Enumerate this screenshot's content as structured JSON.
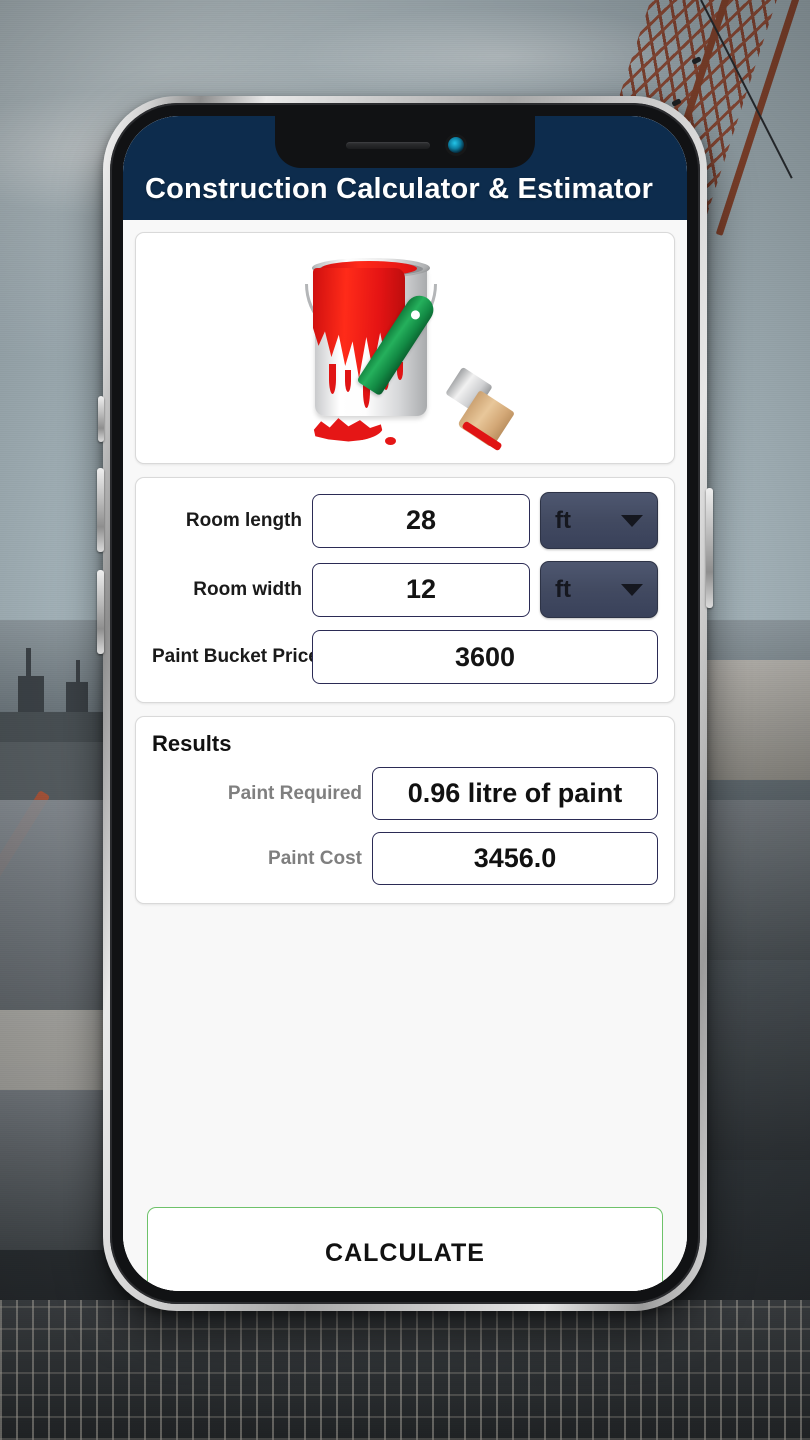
{
  "app": {
    "header": {
      "title": "Construction Calculator & Estimator",
      "background_color": "#0d2c4d",
      "text_color": "#ffffff"
    },
    "hero_image": {
      "alt": "paint-bucket-and-brush"
    },
    "inputs": {
      "fields": [
        {
          "label": "Room length",
          "value": "28",
          "unit": "ft",
          "has_unit_select": true
        },
        {
          "label": "Room width",
          "value": "12",
          "unit": "ft",
          "has_unit_select": true
        },
        {
          "label": "Paint Bucket Price",
          "value": "3600",
          "unit": "",
          "has_unit_select": false
        }
      ]
    },
    "results": {
      "title": "Results",
      "rows": [
        {
          "label": "Paint Required",
          "value": "0.96 litre of paint"
        },
        {
          "label": "Paint Cost",
          "value": "3456.0"
        }
      ],
      "label_color": "#7f7f7f"
    },
    "actions": {
      "calculate_label": "CALCULATE",
      "calculate_border_color": "#6ec26a"
    },
    "icons": {
      "chevron_down": "chevron-down-icon",
      "camera": "front-camera-icon",
      "speaker": "earpiece-speaker-icon"
    }
  }
}
